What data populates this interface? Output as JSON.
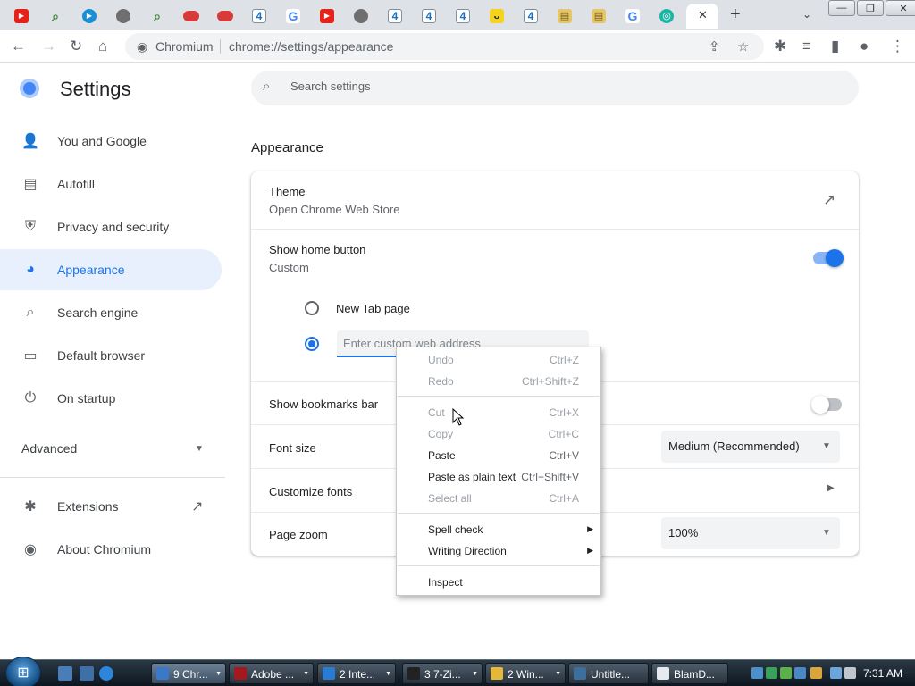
{
  "tabs": {
    "close_glyph": "✕",
    "new_tab_glyph": "+",
    "search_glyph": "⌄",
    "items": [
      {
        "icon": "youtube-icon",
        "glyph": "▶"
      },
      {
        "icon": "search-icon",
        "glyph": "⌕"
      },
      {
        "icon": "play-icon",
        "glyph": "▶"
      },
      {
        "icon": "globe-icon",
        "glyph": ""
      },
      {
        "icon": "search-icon",
        "glyph": "⌕"
      },
      {
        "icon": "red-icon",
        "glyph": ""
      },
      {
        "icon": "red-icon",
        "glyph": ""
      },
      {
        "icon": "four-icon",
        "glyph": "4"
      },
      {
        "icon": "google-icon",
        "glyph": "G"
      },
      {
        "icon": "youtube-icon",
        "glyph": "▶"
      },
      {
        "icon": "globe-icon",
        "glyph": ""
      },
      {
        "icon": "four-icon",
        "glyph": "4"
      },
      {
        "icon": "four-icon",
        "glyph": "4"
      },
      {
        "icon": "four-icon",
        "glyph": "4"
      },
      {
        "icon": "smile-icon",
        "glyph": "ᴗ"
      },
      {
        "icon": "four-icon",
        "glyph": "4"
      },
      {
        "icon": "document-icon",
        "glyph": "▤"
      },
      {
        "icon": "document-icon",
        "glyph": "▤"
      },
      {
        "icon": "google-icon",
        "glyph": "G"
      },
      {
        "icon": "teal-icon",
        "glyph": "◎"
      }
    ]
  },
  "window": {
    "minimize": "—",
    "maximize": "❐",
    "close": "✕"
  },
  "toolbar": {
    "back": "←",
    "forward": "→",
    "reload": "↻",
    "home": "⌂",
    "site_name": "Chromium",
    "url": "chrome://settings/appearance",
    "share": "⇪",
    "star": "☆",
    "extensions": "✱",
    "media": "≡",
    "sidepanel": "▮",
    "profile": "●",
    "menu": "⋮"
  },
  "settings": {
    "title": "Settings",
    "search_placeholder": "Search settings",
    "search_glyph": "⌕",
    "nav": [
      {
        "label": "You and Google",
        "icon": "👤"
      },
      {
        "label": "Autofill",
        "icon": "▤"
      },
      {
        "label": "Privacy and security",
        "icon": "⛨"
      },
      {
        "label": "Appearance",
        "icon": "◕"
      },
      {
        "label": "Search engine",
        "icon": "⌕"
      },
      {
        "label": "Default browser",
        "icon": "▭"
      },
      {
        "label": "On startup",
        "icon": "⏻"
      }
    ],
    "advanced": "Advanced",
    "advanced_caret": "▼",
    "extensions": "Extensions",
    "extensions_icon": "✱",
    "about": "About Chromium",
    "about_icon": "◉",
    "external_glyph": "↗"
  },
  "appearance": {
    "section_title": "Appearance",
    "theme_label": "Theme",
    "theme_sub": "Open Chrome Web Store",
    "home_label": "Show home button",
    "home_sub": "Custom",
    "home_toggle_on": true,
    "radio_newtab": "New Tab page",
    "custom_placeholder": "Enter custom web address",
    "bookmarks_label": "Show bookmarks bar",
    "bookmarks_toggle_on": false,
    "font_size_label": "Font size",
    "font_size_value": "Medium (Recommended)",
    "customize_fonts_label": "Customize fonts",
    "page_zoom_label": "Page zoom",
    "page_zoom_value": "100%",
    "caret": "▼",
    "arrow": "▶"
  },
  "context_menu": {
    "items": [
      {
        "label": "Undo",
        "shortcut": "Ctrl+Z",
        "disabled": true
      },
      {
        "label": "Redo",
        "shortcut": "Ctrl+Shift+Z",
        "disabled": true
      },
      {
        "label": "Cut",
        "shortcut": "Ctrl+X",
        "disabled": true
      },
      {
        "label": "Copy",
        "shortcut": "Ctrl+C",
        "disabled": true
      },
      {
        "label": "Paste",
        "shortcut": "Ctrl+V",
        "disabled": false
      },
      {
        "label": "Paste as plain text",
        "shortcut": "Ctrl+Shift+V",
        "disabled": false
      },
      {
        "label": "Select all",
        "shortcut": "Ctrl+A",
        "disabled": true
      },
      {
        "label": "Spell check",
        "shortcut": "",
        "disabled": false,
        "submenu": true
      },
      {
        "label": "Writing Direction",
        "shortcut": "",
        "disabled": false,
        "submenu": true
      },
      {
        "label": "Inspect",
        "shortcut": "",
        "disabled": false
      }
    ],
    "submenu_glyph": "▶"
  },
  "taskbar": {
    "start_glyph": "⊞",
    "buttons": [
      {
        "label": "9 Chr...",
        "color": "#3a78c9"
      },
      {
        "label": "Adobe ...",
        "color": "#a3191d"
      },
      {
        "label": "2 Inte...",
        "color": "#2a7bd4"
      },
      {
        "label": "3 7-Zi...",
        "color": "#222222"
      },
      {
        "label": "2 Win...",
        "color": "#e6b83a"
      },
      {
        "label": "Untitle...",
        "color": "#3d6e9c"
      },
      {
        "label": "BlamD...",
        "color": "#e6eaf0"
      }
    ],
    "clock": "7:31 AM"
  },
  "colors": {
    "accent": "#1a73e8",
    "nav_active_bg": "#e8f0fe"
  }
}
